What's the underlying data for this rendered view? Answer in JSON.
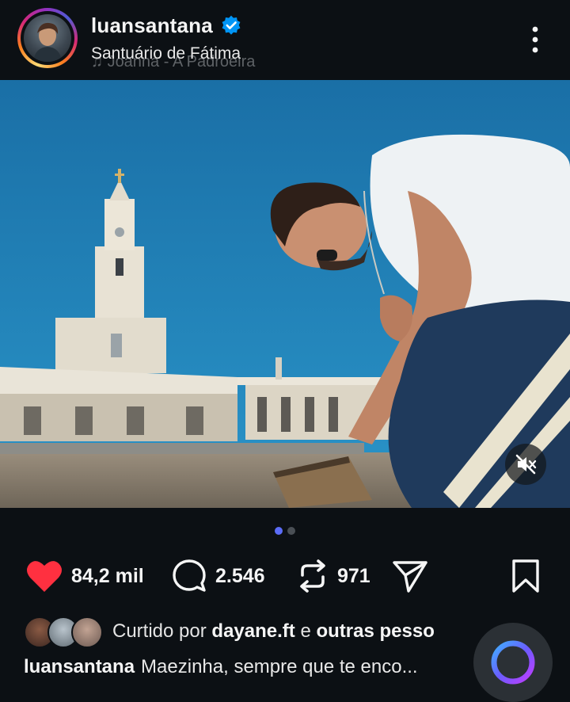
{
  "header": {
    "username": "luansantana",
    "verified": true,
    "location": "Santuário de Fátima",
    "music_ghost": "Joanna - A Padroeira",
    "more_icon": "more-vertical-icon"
  },
  "post": {
    "photo_description_icon": "photo",
    "mute_icon": "volume-off-icon",
    "carousel": {
      "total": 2,
      "active_index": 1
    }
  },
  "actions": {
    "likes_count": "84,2 mil",
    "comments_count": "2.546",
    "reposts_count": "971",
    "like_color": "#ff3040"
  },
  "liked_by": {
    "prefix": "Curtido por",
    "user": "dayane.ft",
    "connector": "e",
    "others": "outras pesso"
  },
  "caption": {
    "user": "luansantana",
    "text": "Maezinha, sempre que te enco..."
  },
  "colors": {
    "background": "#0c1014",
    "accent_blue": "#0095f6",
    "dot_active": "#5b6cf7"
  }
}
